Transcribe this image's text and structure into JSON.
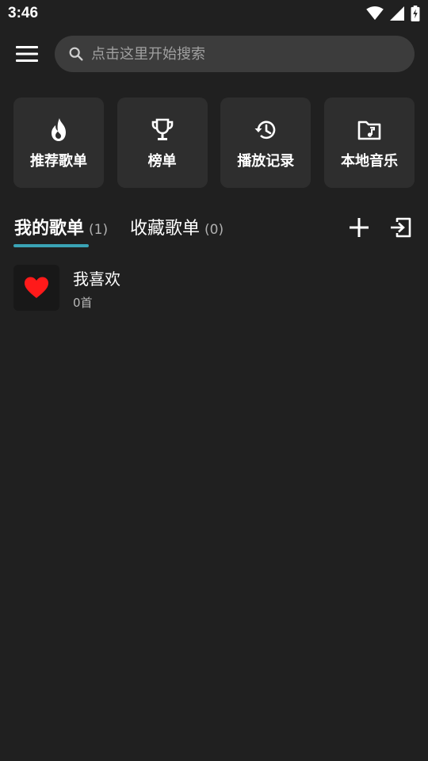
{
  "status_bar": {
    "time": "3:46"
  },
  "search": {
    "placeholder": "点击这里开始搜索"
  },
  "quick_actions": [
    {
      "label": "推荐歌单",
      "icon": "fire-icon"
    },
    {
      "label": "榜单",
      "icon": "trophy-icon"
    },
    {
      "label": "播放记录",
      "icon": "history-icon"
    },
    {
      "label": "本地音乐",
      "icon": "music-folder-icon"
    }
  ],
  "tabs": [
    {
      "label": "我的歌单",
      "count": "(1)",
      "active": true
    },
    {
      "label": "收藏歌单",
      "count": "(0)",
      "active": false
    }
  ],
  "playlists": [
    {
      "title": "我喜欢",
      "count": "0首",
      "icon": "heart-icon"
    }
  ],
  "colors": {
    "background": "#202020",
    "card": "#2e2e2e",
    "accent": "#3aa3b5",
    "heart": "#ff1a1a"
  }
}
